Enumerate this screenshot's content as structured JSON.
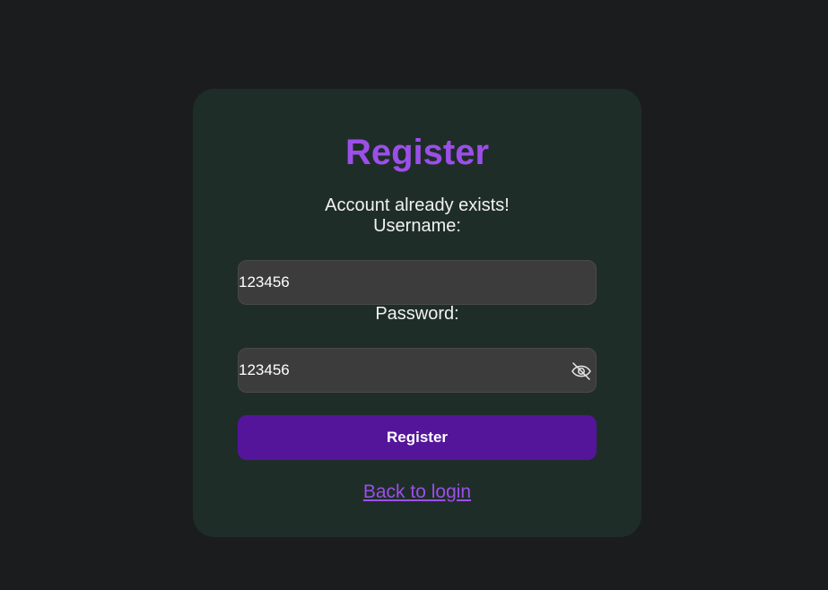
{
  "colors": {
    "page_bg": "#1b1c1e",
    "card_bg": "#1f2d29",
    "accent": "#9b4fe8",
    "button_bg": "#54159b",
    "input_bg": "#3c3c3c",
    "text": "#f2f2f2"
  },
  "form": {
    "title": "Register",
    "message": "Account already exists!",
    "username_label": "Username:",
    "username_value": "123456",
    "password_label": "Password:",
    "password_value": "123456",
    "toggle_icon": "eye-off-icon",
    "submit_label": "Register",
    "back_link": "Back to login"
  }
}
